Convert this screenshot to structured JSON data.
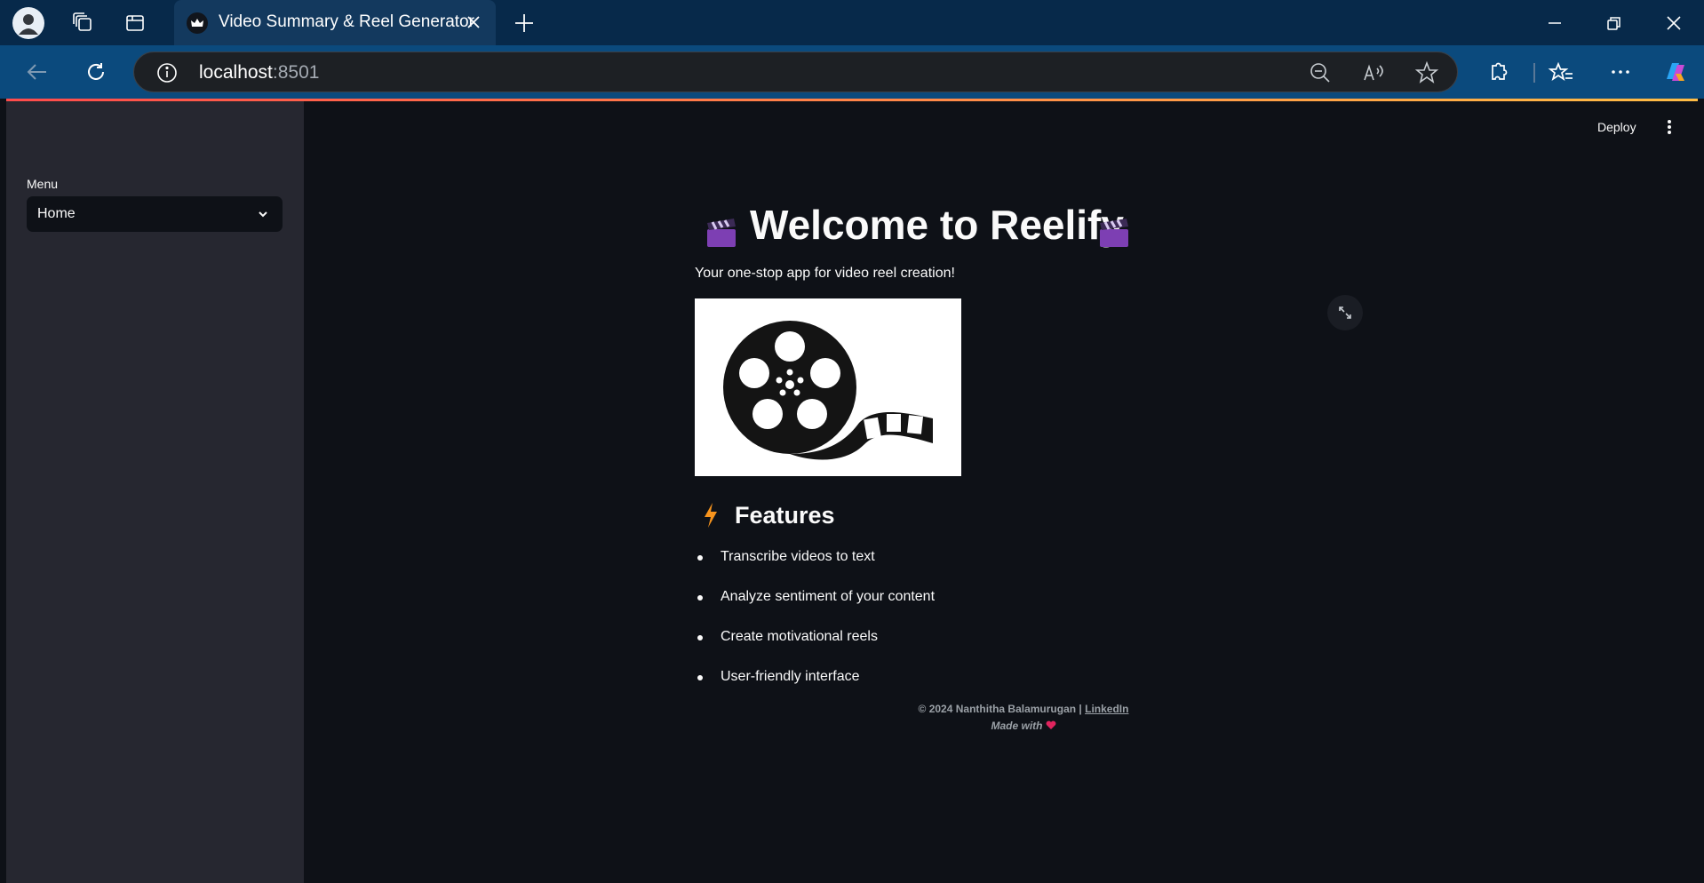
{
  "browser": {
    "tab_title": "Video Summary & Reel Generator",
    "url_host": "localhost",
    "url_port": ":8501"
  },
  "sidebar": {
    "menu_label": "Menu",
    "select_value": "Home"
  },
  "header": {
    "deploy_label": "Deploy"
  },
  "main": {
    "title": "Welcome to Reelify",
    "subtitle": "Your one-stop app for video reel creation!",
    "features_heading": "Features",
    "features": [
      "Transcribe videos to text",
      "Analyze sentiment of your content",
      "Create motivational reels",
      "User-friendly interface"
    ],
    "footer": {
      "copyright": "© 2024 Nanthitha Balamurugan | ",
      "link_label": "LinkedIn",
      "made_with": "Made with"
    }
  },
  "colors": {
    "tabbar_bg": "#07294a",
    "addrbar_bg": "#0b4a7d",
    "app_bg": "#0e1117",
    "sidebar_bg": "#262730",
    "accent_bolt": "#f7941d",
    "heart": "#e0245e"
  }
}
